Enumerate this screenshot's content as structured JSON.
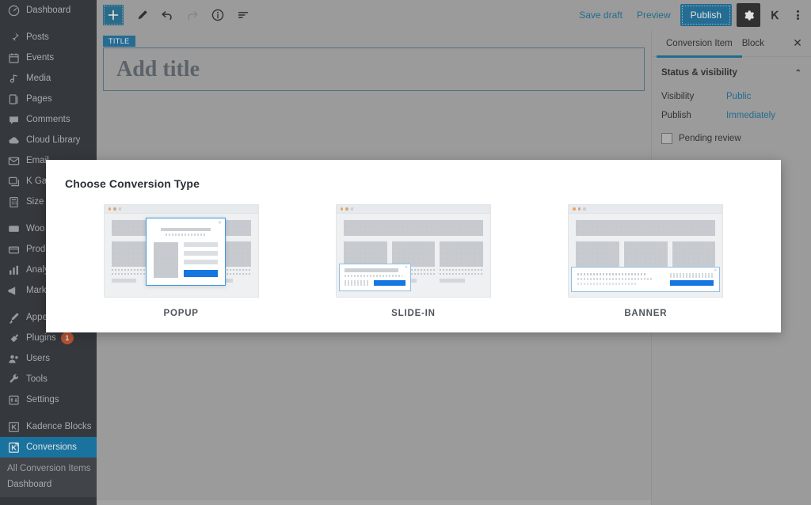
{
  "sidebar": {
    "items": [
      {
        "label": "Dashboard",
        "icon": "dashboard-icon",
        "current": false,
        "sep": false
      },
      {
        "label": "Posts",
        "icon": "pin-icon",
        "current": false,
        "sep": true
      },
      {
        "label": "Events",
        "icon": "calendar-icon",
        "current": false,
        "sep": false
      },
      {
        "label": "Media",
        "icon": "media-icon",
        "current": false,
        "sep": false
      },
      {
        "label": "Pages",
        "icon": "pages-icon",
        "current": false,
        "sep": false
      },
      {
        "label": "Comments",
        "icon": "comment-icon",
        "current": false,
        "sep": false
      },
      {
        "label": "Cloud Library",
        "icon": "cloud-icon",
        "current": false,
        "sep": false
      },
      {
        "label": "Email",
        "icon": "envelope-icon",
        "current": false,
        "sep": false
      },
      {
        "label": "K Gal",
        "icon": "gallery-icon",
        "current": false,
        "sep": false
      },
      {
        "label": "Size",
        "icon": "calculator-icon",
        "current": false,
        "sep": false
      },
      {
        "label": "Woo",
        "icon": "woocommerce-icon",
        "current": false,
        "sep": true
      },
      {
        "label": "Prod",
        "icon": "products-icon",
        "current": false,
        "sep": false
      },
      {
        "label": "Analy",
        "icon": "analytics-icon",
        "current": false,
        "sep": false
      },
      {
        "label": "Mark",
        "icon": "megaphone-icon",
        "current": false,
        "sep": false
      },
      {
        "label": "Appe",
        "icon": "appearance-brush-icon",
        "current": false,
        "sep": true
      },
      {
        "label": "Plugins",
        "icon": "plug-icon",
        "current": false,
        "sep": false,
        "badge": "1"
      },
      {
        "label": "Users",
        "icon": "users-icon",
        "current": false,
        "sep": false
      },
      {
        "label": "Tools",
        "icon": "wrench-icon",
        "current": false,
        "sep": false
      },
      {
        "label": "Settings",
        "icon": "settings-sliders-icon",
        "current": false,
        "sep": false
      },
      {
        "label": "Kadence Blocks",
        "icon": "kadence-icon",
        "current": false,
        "sep": true
      },
      {
        "label": "Conversions",
        "icon": "kadence-conversions-icon",
        "current": true,
        "sep": false
      }
    ],
    "submenu": [
      {
        "label": "All Conversion Items"
      },
      {
        "label": "Dashboard"
      }
    ]
  },
  "toolbar": {
    "add_block_label": "+",
    "tools": [
      {
        "name": "add-block-inserter",
        "icon": "plus-icon"
      },
      {
        "name": "edit-tool-button",
        "icon": "pencil-icon"
      },
      {
        "name": "undo-button",
        "icon": "undo-icon"
      },
      {
        "name": "redo-button",
        "icon": "redo-icon"
      },
      {
        "name": "details-button",
        "icon": "info-icon"
      },
      {
        "name": "list-view-button",
        "icon": "list-view-icon"
      }
    ],
    "save_draft_label": "Save draft",
    "preview_label": "Preview",
    "publish_label": "Publish",
    "settings_icon": "gear-icon",
    "kadence_icon": "kadence-icon",
    "more_menu_icon": "kebab-menu-icon"
  },
  "canvas": {
    "title_tag": "TITLE",
    "title_placeholder": "Add title"
  },
  "settings_panel": {
    "tabs": [
      {
        "label": "Conversion Item",
        "active": true
      },
      {
        "label": "Block",
        "active": false
      }
    ],
    "close_label": "✕",
    "section_title": "Status & visibility",
    "collapse_chevron": "⌃",
    "rows": [
      {
        "label": "Visibility",
        "value": "Public"
      },
      {
        "label": "Publish",
        "value": "Immediately"
      }
    ],
    "pending_review_label": "Pending review"
  },
  "modal": {
    "title": "Choose Conversion Type",
    "types": [
      {
        "label": "POPUP",
        "name": "conversion-type-popup"
      },
      {
        "label": "SLIDE-IN",
        "name": "conversion-type-slide-in"
      },
      {
        "label": "BANNER",
        "name": "conversion-type-banner"
      }
    ]
  },
  "colors": {
    "admin_bg": "#23282d",
    "admin_submenu_bg": "#32373c",
    "accent_blue": "#0073aa",
    "publish_blue": "#0d6a9a",
    "link_blue": "#0b6a94",
    "cta_blue": "#1577e0",
    "overlay_gray": "#a6a6a6",
    "badge_red": "#ca4a1f"
  }
}
